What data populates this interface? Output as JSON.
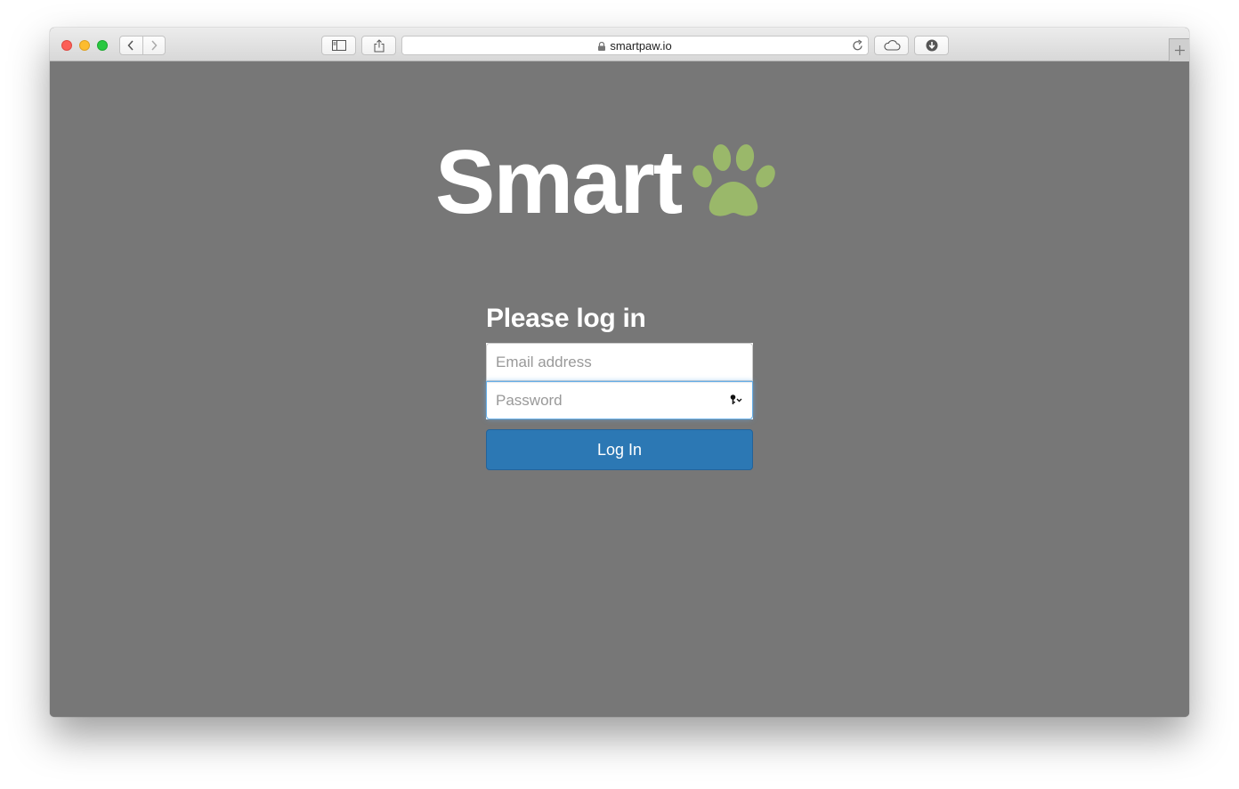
{
  "browser": {
    "url": "smartpaw.io",
    "icons": {
      "back": "chevron-left-icon",
      "forward": "chevron-right-icon",
      "sidebar": "sidebar-icon",
      "share": "share-icon",
      "lock": "lock-icon",
      "reload": "reload-icon",
      "icloud": "cloud-icon",
      "downloads": "download-icon",
      "new_tab": "plus-icon"
    }
  },
  "logo": {
    "text": "Smart",
    "accent_color": "#9ab86a"
  },
  "login": {
    "title": "Please log in",
    "email_placeholder": "Email address",
    "password_placeholder": "Password",
    "button_label": "Log In",
    "button_color": "#2c78b4"
  },
  "colors": {
    "page_background": "#777777"
  }
}
